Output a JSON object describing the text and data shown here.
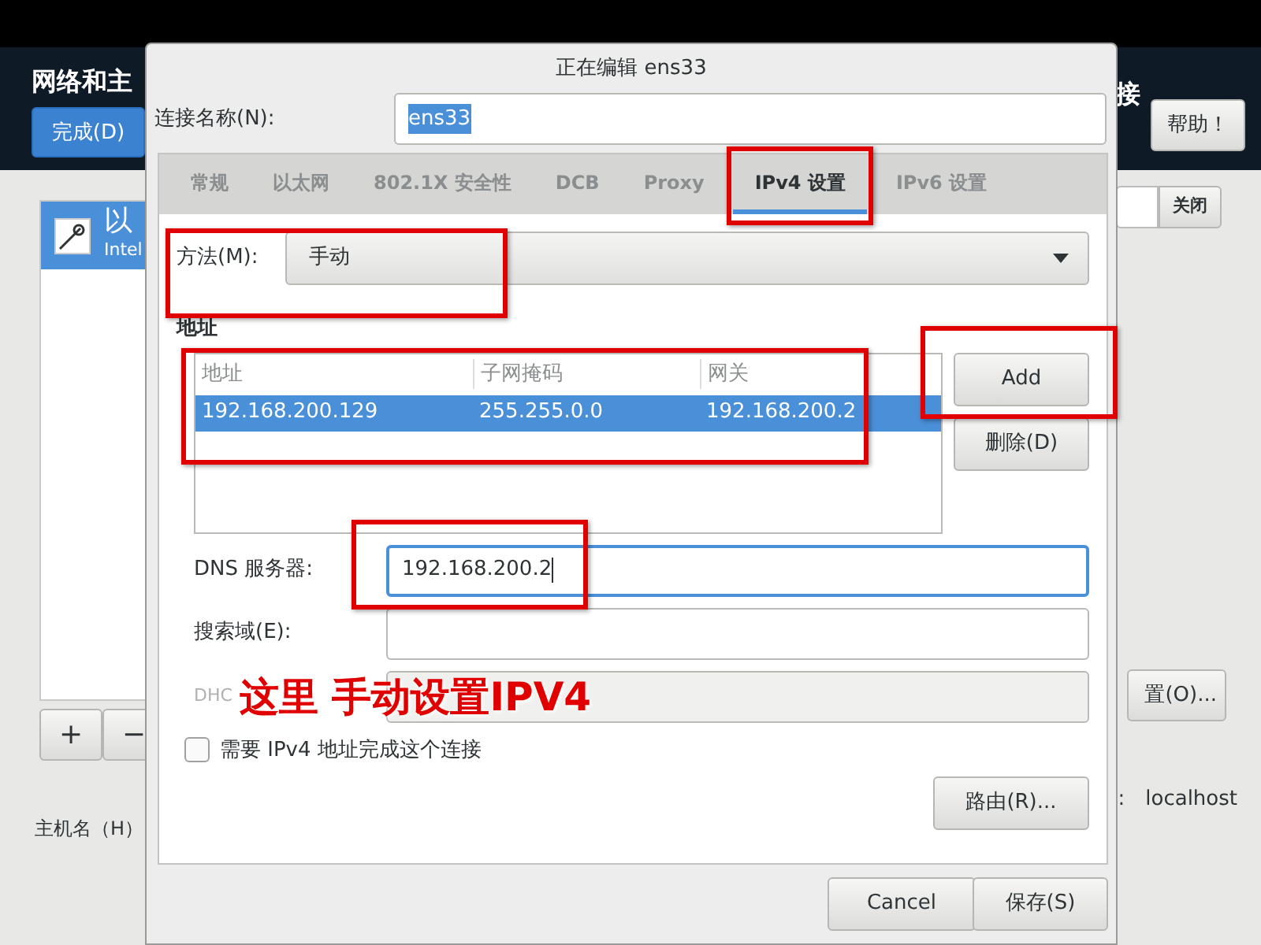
{
  "background_window": {
    "title": "网络和主",
    "done_button": "完成(D)",
    "title_right": "接",
    "help_button": "帮助！",
    "devices": [
      {
        "name": "以",
        "detail": "Intel",
        "selected": true
      }
    ],
    "toggle_button": "关闭",
    "add_button": "+",
    "remove_button": "−",
    "configure_button": "置(O)...",
    "hostname_label": "主机名（H）",
    "hostname_colon": ":",
    "hostname_value": "localhost"
  },
  "dialog": {
    "title": "正在编辑 ens33",
    "connection_name_label": "连接名称(N):",
    "connection_name": "ens33",
    "connection_name_selected": true,
    "tabs": [
      {
        "label": "常规",
        "selected": false
      },
      {
        "label": "以太网",
        "selected": false
      },
      {
        "label": "802.1X 安全性",
        "selected": false
      },
      {
        "label": "DCB",
        "selected": false
      },
      {
        "label": "Proxy",
        "selected": false
      },
      {
        "label": "IPv4 设置",
        "selected": true
      },
      {
        "label": "IPv6 设置",
        "selected": false
      }
    ],
    "method_label": "方法(M):",
    "method": "手动",
    "addresses_heading": "地址",
    "address_columns": [
      "地址",
      "子网掩码",
      "网关"
    ],
    "address_rows": [
      {
        "cells": [
          "192.168.200.129",
          "255.255.0.0",
          "192.168.200.2"
        ],
        "selected": true
      }
    ],
    "add_button": "Add",
    "delete_button": "删除(D)",
    "fields": [
      {
        "label": "DNS 服务器:",
        "value": "192.168.200.2",
        "focused": true,
        "disabled": false
      },
      {
        "label": "搜索域(E):",
        "focused": false,
        "disabled": false
      },
      {
        "label": "DHC",
        "focused": false,
        "disabled": true
      }
    ],
    "require_ipv4": {
      "label": "需要 IPv4 地址完成这个连接",
      "checked": false
    },
    "routes_button": "路由(R)...",
    "cancel_button": "Cancel",
    "save_button": "保存(S)"
  },
  "annotation": {
    "text": "这里 手动设置IPV4"
  }
}
